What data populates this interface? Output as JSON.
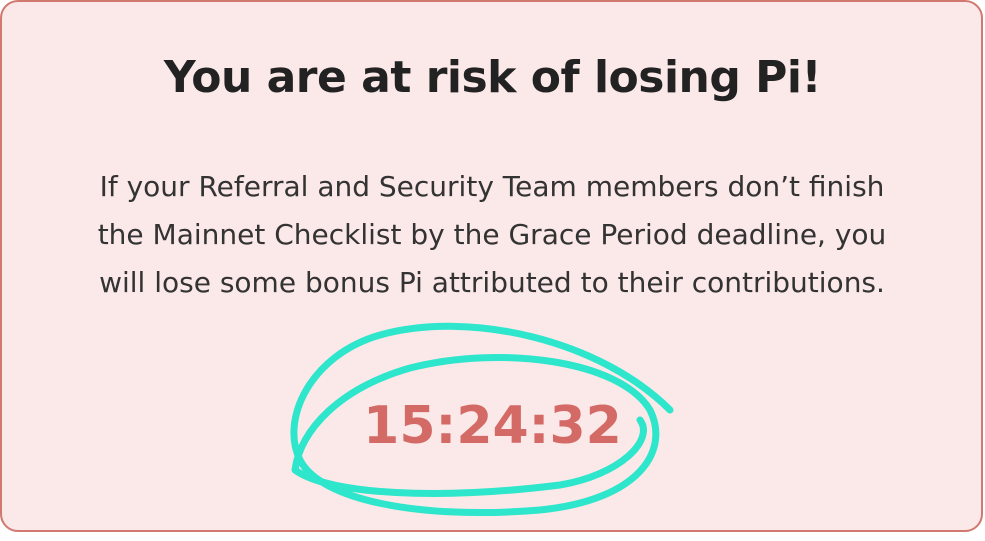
{
  "warning": {
    "title": "You are at risk of losing Pi!",
    "message": "If your Referral and Security Team members don’t finish the Mainnet Checklist by the Grace Period deadline, you will lose some bonus Pi attributed to their contributions.",
    "countdown": "15:24:32"
  }
}
